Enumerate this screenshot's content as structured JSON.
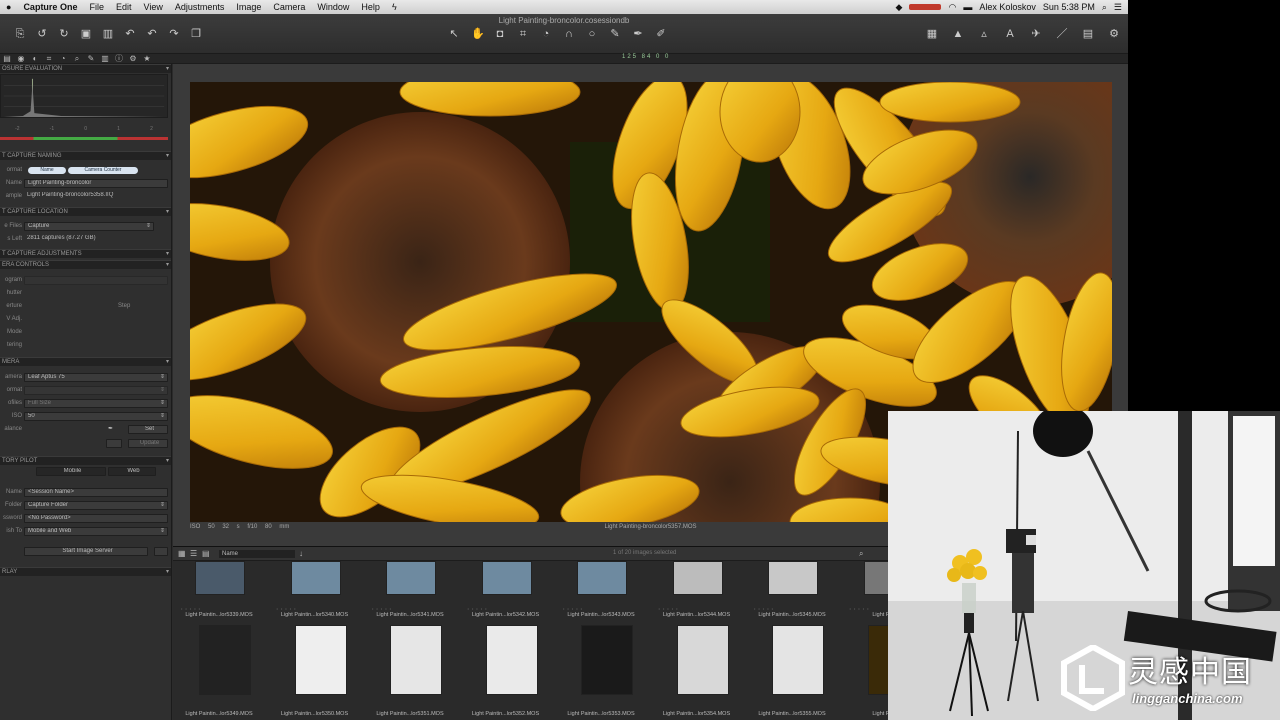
{
  "menubar": {
    "app": "Capture One",
    "items": [
      "File",
      "Edit",
      "View",
      "Adjustments",
      "Image",
      "Camera",
      "Window",
      "Help"
    ],
    "user": "Alex Koloskov",
    "clock": "Sun 5:38 PM"
  },
  "window": {
    "title": "Light Painting-broncolor.cosessiondb"
  },
  "subbar": {
    "counts": "125  84  0  0"
  },
  "left": {
    "sections": {
      "exposure": "osure Evaluation",
      "naming": "t Capture Naming",
      "location": "t Capture Location",
      "adjustments": "t Capture Adjustments",
      "camera_controls": "era Controls",
      "camera": "mera",
      "pilot": "tory Pilot",
      "overlay": "rlay"
    },
    "histo_scale": [
      "-2",
      "-1",
      "0",
      "1",
      "2"
    ],
    "naming": {
      "format_label": "ormat",
      "pill1": "Name",
      "pill2": "Camera Counter",
      "name_label": "Name",
      "name_value": "Light Painting-broncolor",
      "sample_label": "ample",
      "sample_value": "Light Painting-broncolor5358.IIQ"
    },
    "location": {
      "files_label": "e Files",
      "files_value": "Capture",
      "left_label": "s Left",
      "left_value": "2811 captures (87.27 GB)"
    },
    "controls": {
      "program": "ogram",
      "shutter": "hutter",
      "aperture": "erture",
      "ev": "V Adj.",
      "mode": "Mode",
      "metering": "tering",
      "step": "Step"
    },
    "camera": {
      "camera_label": "amera",
      "camera_value": "Leaf Aptus 75",
      "format_label": "ormat",
      "profiles_label": "ofiles",
      "profiles_value": "Full Size",
      "iso_label": "ISO",
      "iso_value": "50",
      "balance_label": "alance",
      "set": "Set",
      "update": "Update"
    },
    "pilot": {
      "tab1": "Mobile",
      "tab2": "Web",
      "name_label": "Name",
      "name_value": "<Session Name>",
      "folder_label": "Folder",
      "folder_value": "Capture Folder",
      "password_label": "ssword",
      "password_value": "<No Password>",
      "publish_label": "ish To",
      "publish_value": "Mobile and Web",
      "start": "Start Image Server"
    }
  },
  "viewer": {
    "info": "ISO 50   32 s   f/10   80 mm",
    "filename": "Light Painting-broncolor5357.MOS"
  },
  "browser": {
    "sort": "Name",
    "count": "1 of 20 images selected",
    "row1": [
      "Light Paintin...lor5339.MOS",
      "Light Paintin...lor5340.MOS",
      "Light Paintin...lor5341.MOS",
      "Light Paintin...lor5342.MOS",
      "Light Paintin...lor5343.MOS",
      "Light Paintin...lor5344.MOS",
      "Light Paintin...lor5345.MOS",
      "Light Paintin"
    ],
    "row2": [
      "Light Paintin...lor5349.MOS",
      "Light Paintin...lor5350.MOS",
      "Light Paintin...lor5351.MOS",
      "Light Paintin...lor5352.MOS",
      "Light Paintin...lor5353.MOS",
      "Light Paintin...lor5354.MOS",
      "Light Paintin...lor5355.MOS",
      "Light Paintin"
    ]
  },
  "watermark": {
    "cn": "灵感中国",
    "en": "lingganchina.com"
  }
}
